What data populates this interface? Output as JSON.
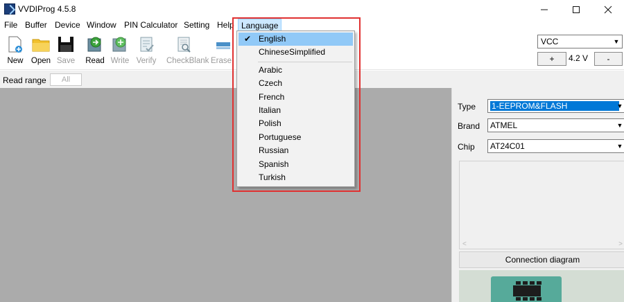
{
  "window": {
    "title": "VVDIProg 4.5.8"
  },
  "menu": [
    "File",
    "Buffer",
    "Device",
    "Window",
    "PIN Calculator",
    "Setting",
    "Help",
    "Language"
  ],
  "toolbar": {
    "new": "New",
    "open": "Open",
    "save": "Save",
    "read": "Read",
    "write": "Write",
    "verify": "Verify",
    "checkblank": "CheckBlank",
    "erase": "Erase"
  },
  "voltage": {
    "supply": "VCC",
    "plus": "+",
    "value": "4.2 V",
    "minus": "-"
  },
  "read_range": {
    "label": "Read range",
    "value": "All"
  },
  "device": {
    "type_label": "Type",
    "type_value": "1-EEPROM&FLASH",
    "brand_label": "Brand",
    "brand_value": "ATMEL",
    "chip_label": "Chip",
    "chip_value": "AT24C01",
    "connection_button": "Connection diagram"
  },
  "language_menu": {
    "checked": "English",
    "items": [
      "English",
      "ChineseSimplified",
      "Arabic",
      "Czech",
      "French",
      "Italian",
      "Polish",
      "Portuguese",
      "Russian",
      "Spanish",
      "Turkish"
    ]
  },
  "colors": {
    "annotation": "#e03030",
    "selection": "#91c9f7",
    "type_highlight": "#0078d7",
    "workspace": "#ababab"
  }
}
